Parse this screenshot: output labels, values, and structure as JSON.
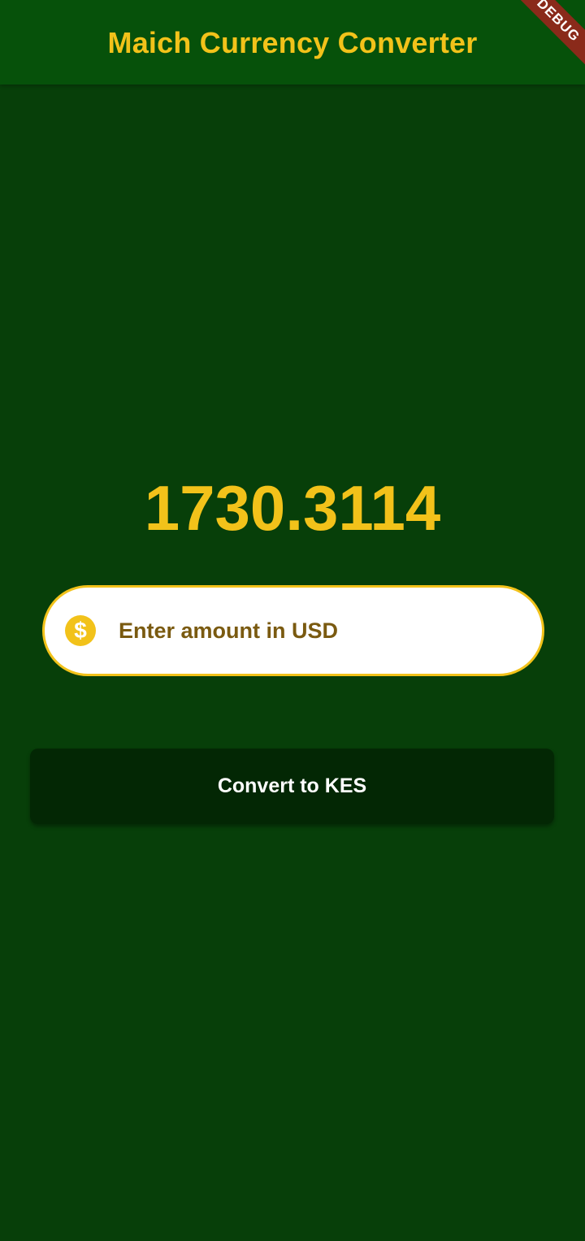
{
  "appbar": {
    "title": "Maich Currency Converter"
  },
  "debug_banner": {
    "label": "DEBUG"
  },
  "result": {
    "value": "1730.3114"
  },
  "amount_input": {
    "placeholder": "Enter amount in USD",
    "value": "",
    "icon": "dollar-circle-icon"
  },
  "convert_button": {
    "label": "Convert to KES"
  },
  "colors": {
    "background": "#073f09",
    "appbar": "#06510a",
    "accent": "#f2c21a",
    "button": "#032704",
    "placeholder_text": "#7a5a10"
  }
}
